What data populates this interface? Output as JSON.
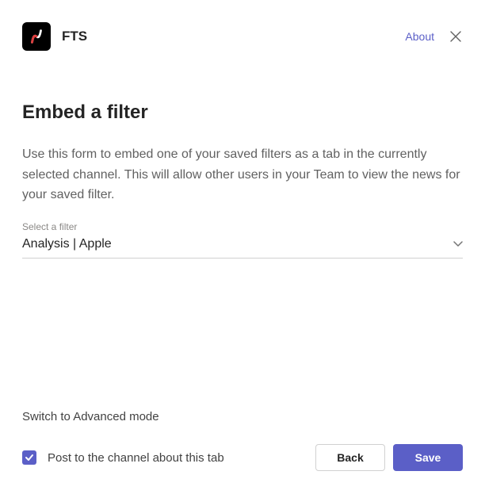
{
  "header": {
    "app_name": "FTS",
    "about_label": "About"
  },
  "main": {
    "title": "Embed a filter",
    "description": "Use this form to embed one of your saved filters as a tab in the currently selected channel. This will allow other users in your Team to view the news for your saved filter.",
    "filter_field_label": "Select a filter",
    "filter_selected_value": "Analysis | Apple",
    "advanced_mode_label": "Switch to Advanced mode"
  },
  "footer": {
    "checkbox_label": "Post to the channel about this tab",
    "checkbox_checked": true,
    "back_label": "Back",
    "save_label": "Save"
  },
  "icons": {
    "app": "fts-logo",
    "close": "close-icon",
    "chevron_down": "chevron-down-icon",
    "checkmark": "checkmark-icon"
  }
}
